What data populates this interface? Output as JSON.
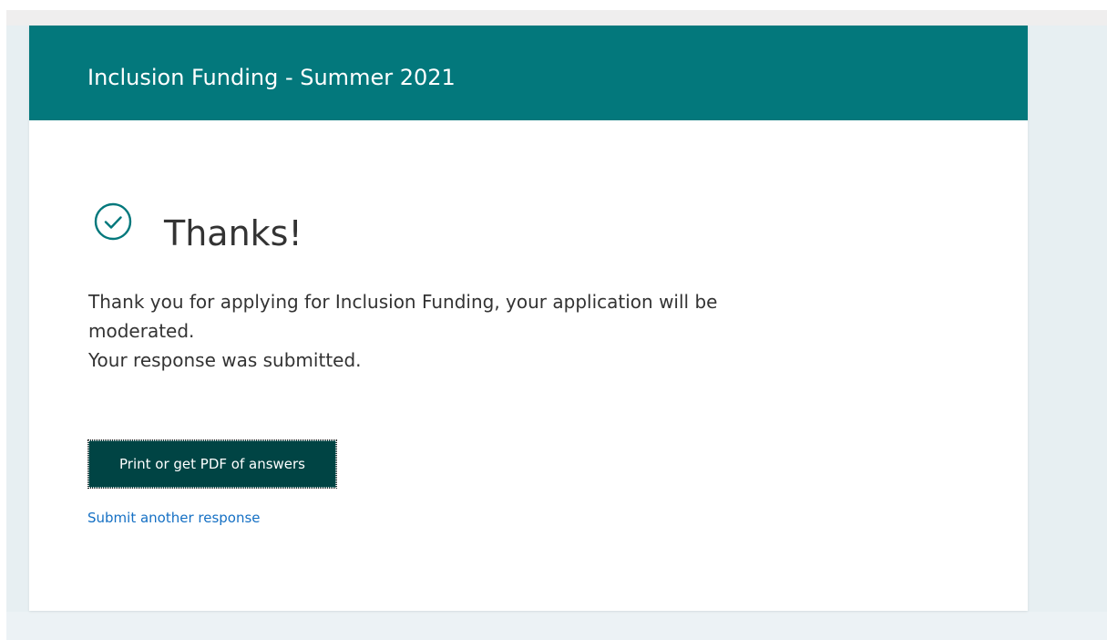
{
  "form": {
    "title": "Inclusion Funding - Summer 2021"
  },
  "confirmation": {
    "icon": "checkmark-circle-icon",
    "heading": "Thanks!",
    "message_line1": "Thank you for applying for Inclusion Funding, your application will be",
    "message_line2": "moderated.",
    "status_line": "Your response was submitted."
  },
  "actions": {
    "print_label": "Print or get PDF of answers",
    "submit_another_label": "Submit another response"
  },
  "colors": {
    "banner": "#03787c",
    "button": "#004444",
    "link": "#1570c4",
    "text": "#333333",
    "icon": "#03787c"
  }
}
